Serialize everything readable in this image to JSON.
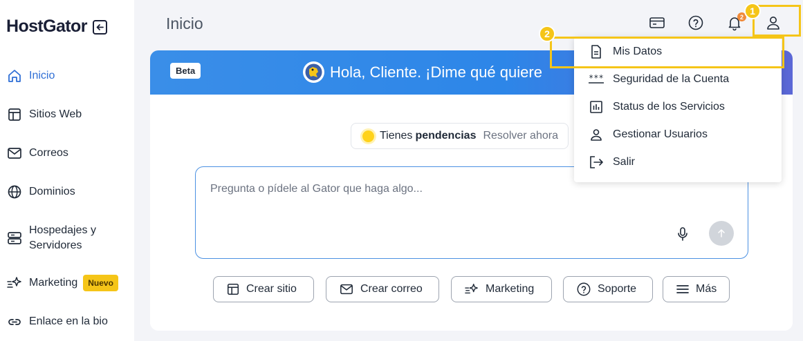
{
  "brand": {
    "name": "HostGator"
  },
  "sidebar": {
    "items": [
      {
        "label": "Inicio",
        "icon": "home-icon",
        "active": true
      },
      {
        "label": "Sitios Web",
        "icon": "layout-icon"
      },
      {
        "label": "Correos",
        "icon": "mail-icon"
      },
      {
        "label": "Dominios",
        "icon": "globe-icon"
      },
      {
        "label": "Hospedajes y Servidores",
        "icon": "server-icon"
      },
      {
        "label": "Marketing",
        "icon": "sparkle-icon",
        "badge": "Nuevo"
      },
      {
        "label": "Enlace en la bio",
        "icon": "link-icon"
      }
    ]
  },
  "header": {
    "title": "Inicio",
    "notification_count": "2",
    "icons": [
      "billing-card-icon",
      "help-icon",
      "bell-icon",
      "user-icon"
    ]
  },
  "annotations": {
    "step1": "1",
    "step2": "2",
    "highlight_color": "#f5c518"
  },
  "banner": {
    "beta": "Beta",
    "greeting": "Hola, Cliente. ¡Dime qué quiere"
  },
  "pending": {
    "prefix": "Tienes",
    "strong": "pendencias",
    "action": "Resolver ahora"
  },
  "prompt": {
    "placeholder": "Pregunta o pídele al Gator que haga algo..."
  },
  "quick_actions": [
    {
      "label": "Crear sitio",
      "icon": "layout-icon"
    },
    {
      "label": "Crear correo",
      "icon": "mail-icon"
    },
    {
      "label": "Marketing",
      "icon": "sparkle-icon"
    },
    {
      "label": "Soporte",
      "icon": "help-icon"
    },
    {
      "label": "Más",
      "icon": "menu-icon"
    }
  ],
  "user_menu": {
    "items": [
      {
        "label": "Mis Datos",
        "icon": "document-icon"
      },
      {
        "label": "Seguridad de la Cuenta",
        "icon": "password-icon"
      },
      {
        "label": "Status de los Servicios",
        "icon": "chart-icon"
      },
      {
        "label": "Gestionar Usuarios",
        "icon": "person-icon"
      },
      {
        "label": "Salir",
        "icon": "logout-icon"
      }
    ]
  },
  "colors": {
    "accent": "#2f6fd6",
    "banner_start": "#3a8ee8",
    "banner_end": "#5b67d6",
    "badge": "#f5c518"
  }
}
